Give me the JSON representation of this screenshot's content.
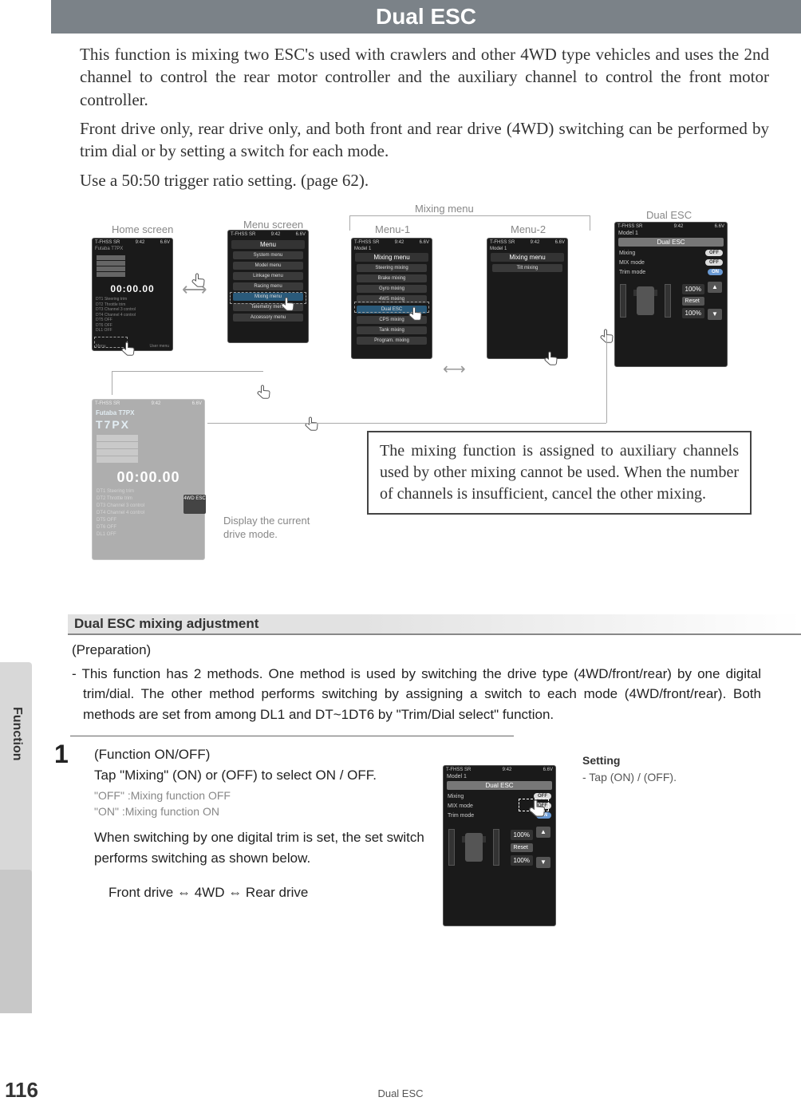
{
  "page_title": "Dual ESC",
  "intro": {
    "p1": "This function is mixing two ESC's used with crawlers and other 4WD type vehicles and uses the 2nd channel to control the rear motor controller and the auxiliary channel to control the front motor controller.",
    "p2": "Front drive only, rear drive only, and both front and rear drive (4WD) switching can be performed by trim dial or by setting a switch for each mode.",
    "p3": "Use a 50:50 trigger ratio setting. (page 62)."
  },
  "diagram": {
    "labels": {
      "home": "Home screen",
      "menu": "Menu screen",
      "mixing_menu": "Mixing menu",
      "menu1": "Menu-1",
      "menu2": "Menu-2",
      "dual_esc": "Dual ESC",
      "drive_note": "Display the current drive mode."
    },
    "status": {
      "sys": "T-FHSS SR",
      "time": "9:42",
      "batt": "6.6V",
      "model": "Model 1"
    },
    "home": {
      "brand": "Futaba T7PX",
      "timer": "00:00.00",
      "footer_left": "Menu",
      "footer_right": "User menu",
      "dt_lines": [
        "DT1  Steering trim",
        "DT2  Throttle trim",
        "DT3  Channel 3 control",
        "DT4  Channel 4 control",
        "DT5  OFF",
        "DT6  OFF",
        "DL1  OFF"
      ]
    },
    "menu_screen": {
      "title": "Menu",
      "items": [
        "System menu",
        "Model menu",
        "Linkage menu",
        "Racing menu",
        "Mixing menu",
        "Telemetry menu",
        "Accessory menu"
      ]
    },
    "menu1": {
      "title": "Mixing menu",
      "items": [
        "Steering mixing",
        "Brake mixing",
        "Gyro mixing",
        "4WS mixing",
        "Dual ESC",
        "CPS mixing",
        "Tank mixing",
        "Program. mixing"
      ]
    },
    "menu2": {
      "title": "Mixing menu",
      "items": [
        "Tilt mixing"
      ]
    },
    "dual_panel": {
      "title": "Dual ESC",
      "rows": {
        "mixing": {
          "label": "Mixing",
          "value": "OFF"
        },
        "mix_mode": {
          "label": "MIX mode",
          "value": "OFF"
        },
        "trim_mode": {
          "label": "Trim mode",
          "value": "ON"
        }
      },
      "pct1": "100%",
      "pct2": "100%",
      "reset": "Reset",
      "up": "▲",
      "down": "▼"
    },
    "icon_4wd": "4WD\nESC",
    "notice": "The mixing function is assigned to auxiliary channels used by other mixing cannot be used. When the number of channels is insufficient, cancel the other mixing."
  },
  "section_header": "Dual ESC mixing adjustment",
  "preparation": {
    "title": "(Preparation)",
    "item": "- This function has 2 methods. One method is used by switching the drive type (4WD/front/rear) by one digital trim/dial. The other method performs switching by assigning a switch to each mode (4WD/front/rear). Both methods are set from among DL1 and DT~1DT6 by \"Trim/Dial select\" function."
  },
  "step1": {
    "num": "1",
    "title": "(Function ON/OFF)",
    "line1": "Tap \"Mixing\" (ON) or (OFF) to select ON / OFF.",
    "opt_off": "\"OFF\"   :Mixing function OFF",
    "opt_on": "\"ON\"    :Mixing function ON",
    "note": "When switching by one digital trim is set, the set switch performs switching as shown below.",
    "cycle": "Front drive ⇔ 4WD ⇔ Rear drive"
  },
  "setting": {
    "title": "Setting",
    "line": "- Tap (ON) / (OFF)."
  },
  "side_tab": "Function",
  "page_number": "116",
  "footer": "Dual ESC"
}
